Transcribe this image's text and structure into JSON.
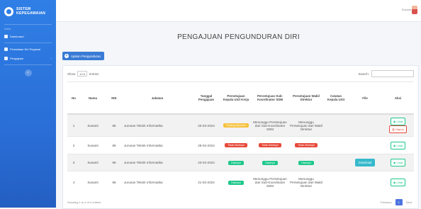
{
  "brand": {
    "line1": "SISTEM",
    "line2": "KEPEGAWAIAN"
  },
  "sidebar": {
    "heading": "Home",
    "items": [
      {
        "label": "Dashboard"
      },
      {
        "label": "Pendataan Diri Pegawai"
      },
      {
        "label": "Pengajuan"
      }
    ]
  },
  "topbar": {
    "user": "Susanti"
  },
  "page": {
    "title": "PENGAJUAN PENGUNDURAN DIRI",
    "add_button": "Ajukan Pengunduran"
  },
  "table_controls": {
    "show": "Show",
    "entries_value": "10",
    "entries": "entries",
    "search": "Search:"
  },
  "columns": [
    "No",
    "Nama",
    "NIK",
    "Jabatan",
    "Tanggal Pengajuan",
    "Persetujuan Kepala Unit Kerja",
    "Persetujuan Sub-Koordinator SDM",
    "Persetujuan Wakil Direktur",
    "Catatan Kepala Unit",
    "File",
    "Aksi"
  ],
  "rows": [
    {
      "no": "1",
      "nama": "Susanti",
      "nik": "86",
      "jabatan": "Jurusan Teknik Informatika",
      "tanggal": "20-03-2024",
      "kepala": "Sedang Diproses",
      "sub": "Menunggu Persetujuan dari Sub-Koordinator SDM",
      "wakil": "Menunggu Persetujuan dari Wakil Direktur",
      "lihat": "Lihat",
      "hapus": "Hapus"
    },
    {
      "no": "2",
      "nama": "Susanti",
      "nik": "86",
      "jabatan": "Jurusan Teknik Informatika",
      "tanggal": "28-02-2024",
      "kepala": "Tidak Disetujui",
      "sub": "Tidak Disetujui",
      "wakil": "Tidak Disetujui",
      "lihat": "Lihat"
    },
    {
      "no": "3",
      "nama": "Susanti",
      "nik": "86",
      "jabatan": "Jurusan Teknik Informatika",
      "tanggal": "23-02-2024",
      "kepala": "Disetujui",
      "sub": "Disetujui",
      "wakil": "Disetujui",
      "file": "Download",
      "lihat": "Lihat"
    },
    {
      "no": "4",
      "nama": "Susanti",
      "nik": "86",
      "jabatan": "Jurusan Teknik Informatika",
      "tanggal": "21-02-2024",
      "kepala": "Disetujui",
      "sub": "Menunggu Persetujuan dari Sub-Koordinator SDM",
      "wakil": "Menunggu Persetujuan dari Wakil Direktur",
      "lihat": "Lihat"
    }
  ],
  "footer": {
    "info": "Showing 1 to 4 of 4 entries",
    "previous": "Previous",
    "page": "1",
    "next": "Next"
  },
  "colors": {
    "sidebar": "#2f7fe6",
    "primary": "#3a7bd5",
    "success": "#1cc88a",
    "danger": "#e74a3b",
    "warning": "#f6c23e",
    "info": "#36b9cc"
  }
}
